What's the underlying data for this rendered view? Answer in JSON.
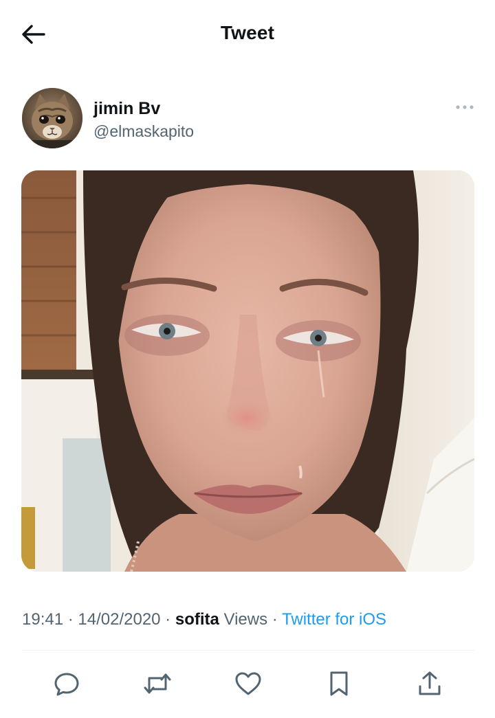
{
  "header": {
    "back_icon": "arrow-left-icon",
    "title": "Tweet"
  },
  "tweet": {
    "author": {
      "display_name": "jimin Bv",
      "handle": "@elmaskapito",
      "avatar": "kitten-face-avatar"
    },
    "more_icon": "more-horizontal-icon",
    "media": "photo-crying-woman-closeup",
    "time": "19:41",
    "sep1": " · ",
    "date": "14/02/2020",
    "sep2": " · ",
    "views_count": "sofita",
    "views_label": " Views",
    "sep3": " · ",
    "source": "Twitter for iOS"
  },
  "actions": [
    {
      "icon": "reply-icon"
    },
    {
      "icon": "retweet-icon"
    },
    {
      "icon": "like-icon"
    },
    {
      "icon": "bookmark-icon"
    },
    {
      "icon": "share-icon"
    }
  ],
  "colors": {
    "text_primary": "#0f1419",
    "text_secondary": "#536471",
    "link": "#1d9bf0",
    "divider": "#eff3f4"
  }
}
